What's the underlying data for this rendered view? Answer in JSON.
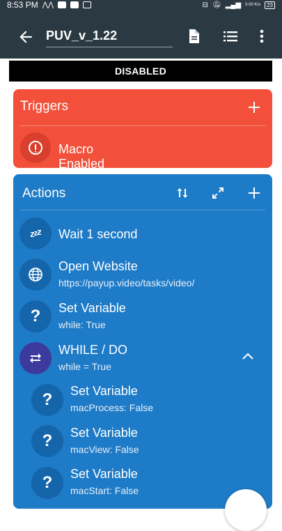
{
  "status_bar": {
    "time": "8:53 PM",
    "network_speed": "0.00 K/s",
    "battery": "23"
  },
  "app_bar": {
    "macro_name": "PUV_v_1.22"
  },
  "banner": {
    "text": "DISABLED"
  },
  "triggers": {
    "header": "Triggers",
    "items": [
      {
        "label": "Macro Enabled",
        "icon": "info-icon"
      }
    ]
  },
  "actions": {
    "header": "Actions",
    "items": [
      {
        "title": "Wait 1 second",
        "subtitle": "",
        "icon": "zzz"
      },
      {
        "title": "Open Website",
        "subtitle": "https://payup.video/tasks/video/",
        "icon": "globe-icon"
      },
      {
        "title": "Set Variable",
        "subtitle": "while: True",
        "icon": "?"
      },
      {
        "title": "WHILE / DO",
        "subtitle": "while = True",
        "icon": "repeat-icon"
      },
      {
        "title": "Set Variable",
        "subtitle": "macProcess: False",
        "icon": "?"
      },
      {
        "title": "Set Variable",
        "subtitle": "macView: False",
        "icon": "?"
      },
      {
        "title": "Set Variable",
        "subtitle": "macStart: False",
        "icon": "?"
      }
    ]
  },
  "colors": {
    "app_bar": "#2b3a42",
    "triggers_bg": "#f2503b",
    "actions_bg": "#1e7bc7",
    "while_icon_bg": "#3d3a9e"
  }
}
